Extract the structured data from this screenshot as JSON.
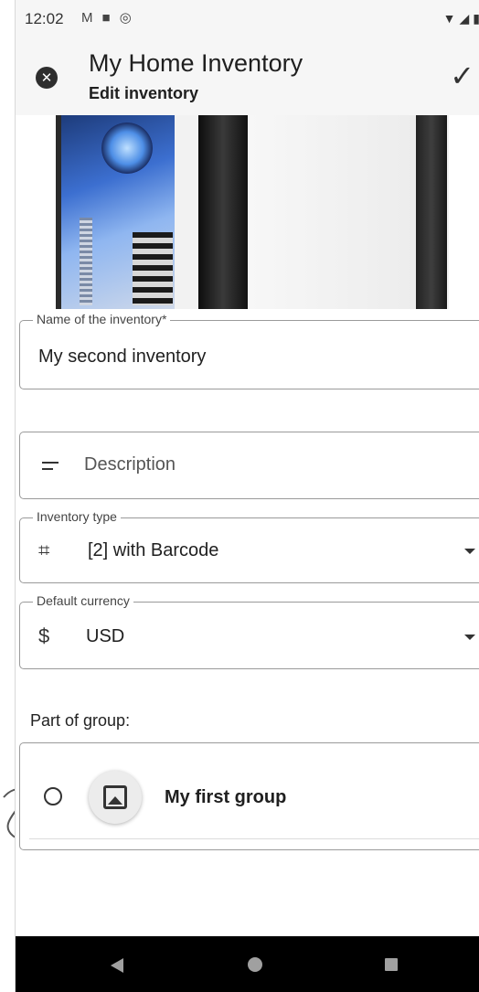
{
  "status_bar": {
    "time": "12:02",
    "icons": [
      "gmail-icon",
      "notification-icon",
      "at-icon"
    ],
    "right_icons": [
      "wifi-icon",
      "signal-icon",
      "battery-icon"
    ]
  },
  "app_bar": {
    "title": "My Home Inventory",
    "subtitle": "Edit inventory",
    "close_icon": "close-circle-icon",
    "confirm_icon": "check-icon"
  },
  "form": {
    "name": {
      "label": "Name of the inventory*",
      "value": "My second inventory"
    },
    "description": {
      "placeholder": "Description",
      "icon": "notes-icon"
    },
    "inventory_type": {
      "label": "Inventory type",
      "value": "[2] with Barcode",
      "icon": "crop-icon"
    },
    "currency": {
      "label": "Default currency",
      "value": "USD",
      "symbol": "$"
    }
  },
  "group_section": {
    "label": "Part of group:",
    "groups": [
      {
        "name": "My first group",
        "selected": false,
        "avatar_icon": "image-placeholder-icon"
      }
    ]
  },
  "nav_bar": {
    "buttons": [
      "back",
      "home",
      "recents"
    ]
  }
}
